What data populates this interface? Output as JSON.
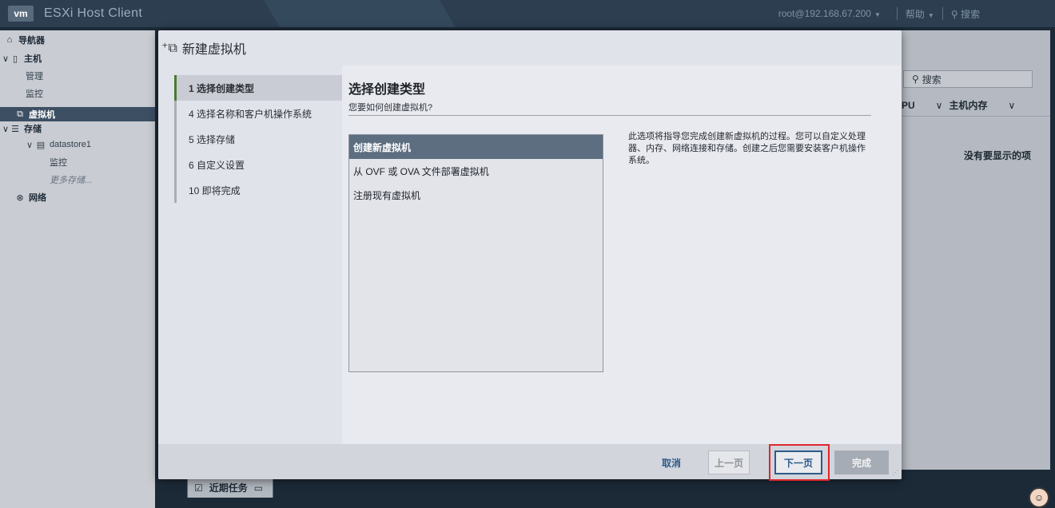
{
  "topbar": {
    "logo": "vm",
    "title": "ESXi Host Client",
    "user": "root@192.168.67.200",
    "help": "帮助",
    "search": "搜索"
  },
  "nav": {
    "navigator": "导航器",
    "host": "主机",
    "manage": "管理",
    "monitor": "监控",
    "vms": "虚拟机",
    "storage": "存储",
    "datastore": "datastore1",
    "ds_monitor": "监控",
    "more_storage": "更多存储...",
    "network": "网络"
  },
  "background": {
    "search": "搜索",
    "col_cpu": "PU",
    "col_memory": "主机内存",
    "empty": "没有要显示的项"
  },
  "recent_tasks": "近期任务",
  "modal": {
    "title": "新建虚拟机",
    "steps": [
      {
        "label": "1  选择创建类型"
      },
      {
        "label": "4  选择名称和客户机操作系统"
      },
      {
        "label": "5  选择存储"
      },
      {
        "label": "6  自定义设置"
      },
      {
        "label": "10  即将完成"
      }
    ],
    "content_title": "选择创建类型",
    "content_subtitle": "您要如何创建虚拟机?",
    "options": [
      "创建新虚拟机",
      "从 OVF 或 OVA 文件部署虚拟机",
      "注册现有虚拟机"
    ],
    "description": "此选项将指导您完成创建新虚拟机的过程。您可以自定义处理器、内存、网络连接和存储。创建之后您需要安装客户机操作系统。",
    "buttons": {
      "cancel": "取消",
      "prev": "上一页",
      "next": "下一页",
      "finish": "完成"
    }
  }
}
